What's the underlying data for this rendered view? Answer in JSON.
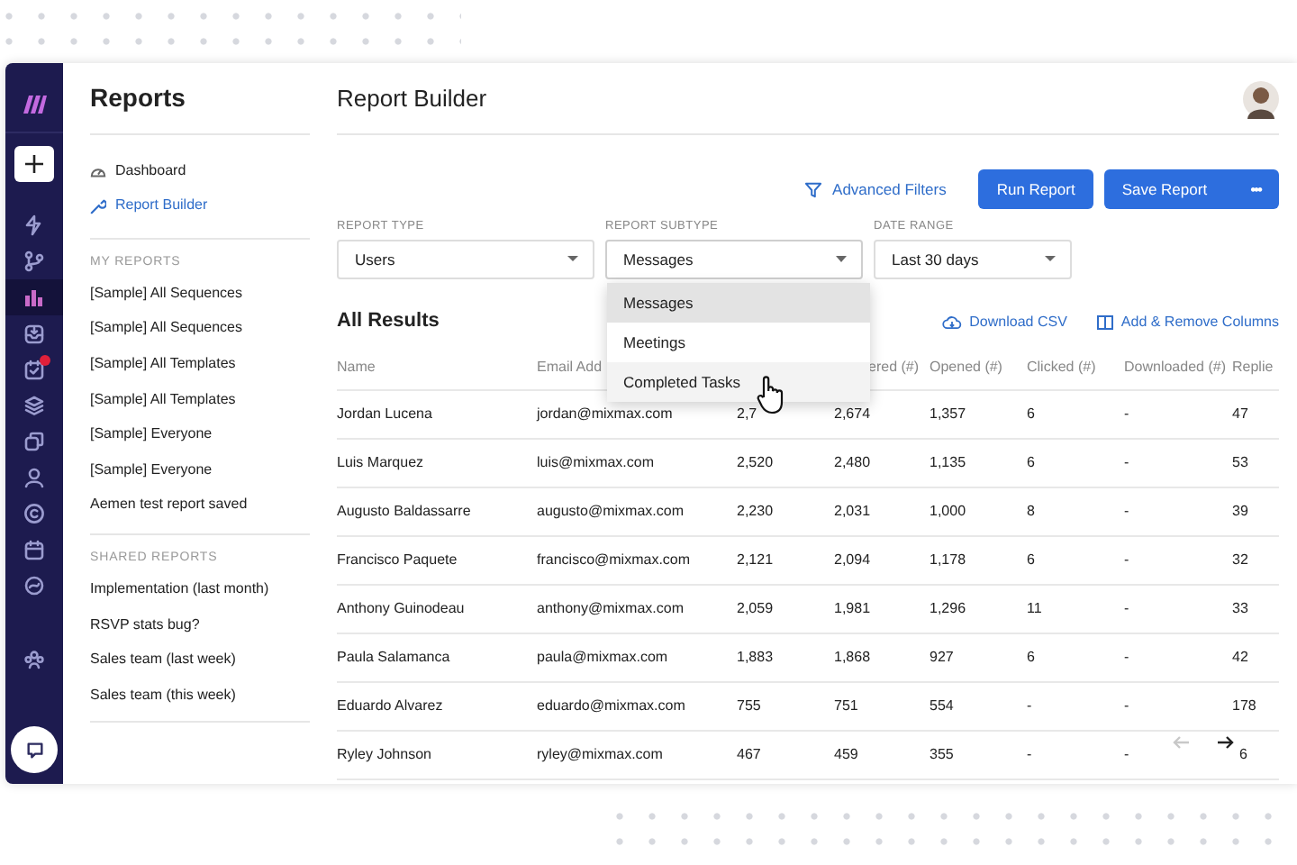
{
  "rail": {
    "items": [
      {
        "kind": "logo",
        "selected": false,
        "alert": false
      },
      {
        "kind": "plus",
        "selected": false,
        "alert": false
      },
      {
        "kind": "bolt",
        "selected": false,
        "alert": false
      },
      {
        "kind": "branch",
        "selected": false,
        "alert": false
      },
      {
        "kind": "chart",
        "selected": true,
        "alert": false
      },
      {
        "kind": "inbox",
        "selected": false,
        "alert": false
      },
      {
        "kind": "task",
        "selected": false,
        "alert": true
      },
      {
        "kind": "layers",
        "selected": false,
        "alert": false
      },
      {
        "kind": "copy",
        "selected": false,
        "alert": false
      },
      {
        "kind": "person",
        "selected": false,
        "alert": false
      },
      {
        "kind": "circle",
        "selected": false,
        "alert": false
      },
      {
        "kind": "calendar",
        "selected": false,
        "alert": false
      },
      {
        "kind": "swirl",
        "selected": false,
        "alert": false
      },
      {
        "kind": "team",
        "selected": false,
        "alert": false
      },
      {
        "kind": "chat",
        "selected": false,
        "alert": false
      }
    ]
  },
  "reports_panel": {
    "title": "Reports",
    "nav": [
      {
        "label": "Dashboard",
        "selected": false
      },
      {
        "label": "Report Builder",
        "selected": true
      }
    ],
    "sections": [
      {
        "heading": "MY REPORTS",
        "items": [
          "[Sample] All Sequences",
          "[Sample] All Sequences",
          "[Sample] All Templates",
          "[Sample] All Templates",
          "[Sample] Everyone",
          "[Sample] Everyone",
          "Aemen test report saved"
        ]
      },
      {
        "heading": "SHARED REPORTS",
        "items": [
          "Implementation (last month)",
          "RSVP stats bug?",
          "Sales team (last week)",
          "Sales team (this week)"
        ]
      }
    ]
  },
  "main": {
    "title": "Report Builder",
    "advanced_filters": "Advanced Filters",
    "buttons": [
      "Run Report",
      "Save Report"
    ],
    "more": "•••",
    "filters": [
      {
        "label": "REPORT TYPE",
        "value": "Users",
        "open": false
      },
      {
        "label": "REPORT SUBTYPE",
        "value": "Messages",
        "open": true
      },
      {
        "label": "DATE RANGE",
        "value": "Last 30 days",
        "open": false
      }
    ],
    "dropdown": [
      {
        "label": "Messages",
        "selected": true,
        "hovered": false
      },
      {
        "label": "Meetings",
        "selected": false,
        "hovered": false
      },
      {
        "label": "Completed Tasks",
        "selected": false,
        "hovered": true
      }
    ],
    "results_title": "All Results",
    "links": [
      {
        "label": "Download CSV"
      },
      {
        "label": "Add & Remove Columns"
      }
    ],
    "table": {
      "columns": [
        "Name",
        "Email Add",
        "",
        "ered (#)",
        "Opened (#)",
        "Clicked (#)",
        "Downloaded (#)",
        "Replie"
      ],
      "rows": [
        [
          "Jordan Lucena",
          "jordan@mixmax.com",
          "2,7",
          "2,674",
          "1,357",
          "6",
          "-",
          "47"
        ],
        [
          "Luis Marquez",
          "luis@mixmax.com",
          "2,520",
          "2,480",
          "1,135",
          "6",
          "-",
          "53"
        ],
        [
          "Augusto Baldassarre",
          "augusto@mixmax.com",
          "2,230",
          "2,031",
          "1,000",
          "8",
          "-",
          "39"
        ],
        [
          "Francisco Paquete",
          "francisco@mixmax.com",
          "2,121",
          "2,094",
          "1,178",
          "6",
          "-",
          "32"
        ],
        [
          "Anthony Guinodeau",
          "anthony@mixmax.com",
          "2,059",
          "1,981",
          "1,296",
          "11",
          "-",
          "33"
        ],
        [
          "Paula Salamanca",
          "paula@mixmax.com",
          "1,883",
          "1,868",
          "927",
          "6",
          "-",
          "42"
        ],
        [
          "Eduardo Alvarez",
          "eduardo@mixmax.com",
          "755",
          "751",
          "554",
          "-",
          "-",
          "178"
        ],
        [
          "Ryley Johnson",
          "ryley@mixmax.com",
          "467",
          "459",
          "355",
          "-",
          "-",
          "6"
        ]
      ]
    },
    "pager": [
      {
        "kind": "prev",
        "disabled": true
      },
      {
        "kind": "next",
        "disabled": false
      }
    ]
  }
}
